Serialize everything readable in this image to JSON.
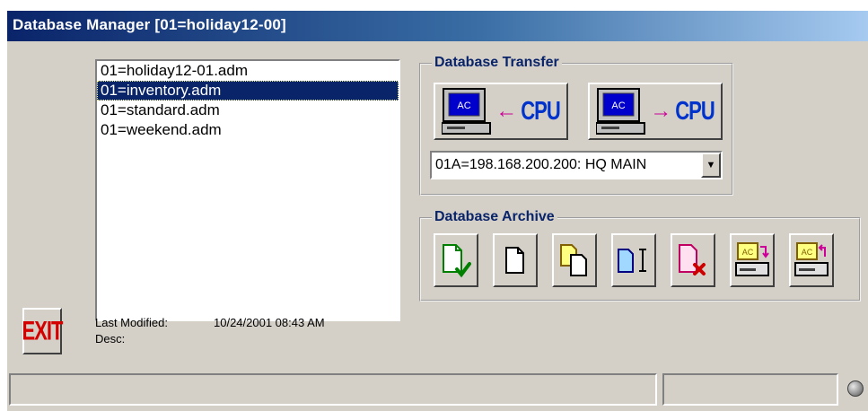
{
  "window": {
    "title": "Database Manager  [01=holiday12-00]"
  },
  "files": {
    "items": [
      {
        "label": "01=holiday12-01.adm",
        "selected": false
      },
      {
        "label": "01=inventory.adm",
        "selected": true
      },
      {
        "label": "01=standard.adm",
        "selected": false
      },
      {
        "label": "01=weekend.adm",
        "selected": false
      }
    ]
  },
  "exit_button": {
    "label": "EXIT",
    "color": "#d40000"
  },
  "details": {
    "last_modified_label": "Last Modified:",
    "last_modified_value": "10/24/2001 08:43 AM",
    "desc_label": "Desc:"
  },
  "transfer": {
    "title": "Database Transfer",
    "upload_button": {
      "screen_label": "AC",
      "cpu_label": "CPU",
      "icon": "receive-from-cpu-icon"
    },
    "download_button": {
      "screen_label": "AC",
      "cpu_label": "CPU",
      "icon": "send-to-cpu-icon"
    },
    "target_select": {
      "value": "01A=198.168.200.200: HQ MAIN"
    }
  },
  "archive": {
    "title": "Database Archive",
    "buttons": [
      {
        "name": "validate",
        "icon": "document-check-icon"
      },
      {
        "name": "new",
        "icon": "new-document-icon"
      },
      {
        "name": "copy",
        "icon": "copy-document-icon"
      },
      {
        "name": "rename",
        "icon": "rename-document-icon"
      },
      {
        "name": "delete",
        "icon": "delete-document-icon"
      },
      {
        "name": "export",
        "icon": "archive-export-icon",
        "screen_label": "AC"
      },
      {
        "name": "import",
        "icon": "archive-import-icon",
        "screen_label": "AC"
      }
    ]
  },
  "statusbar": {
    "message": "",
    "secondary": ""
  },
  "colors": {
    "accent": "#0a246a",
    "face": "#d4d0c8",
    "arrow": "#cc0099"
  }
}
